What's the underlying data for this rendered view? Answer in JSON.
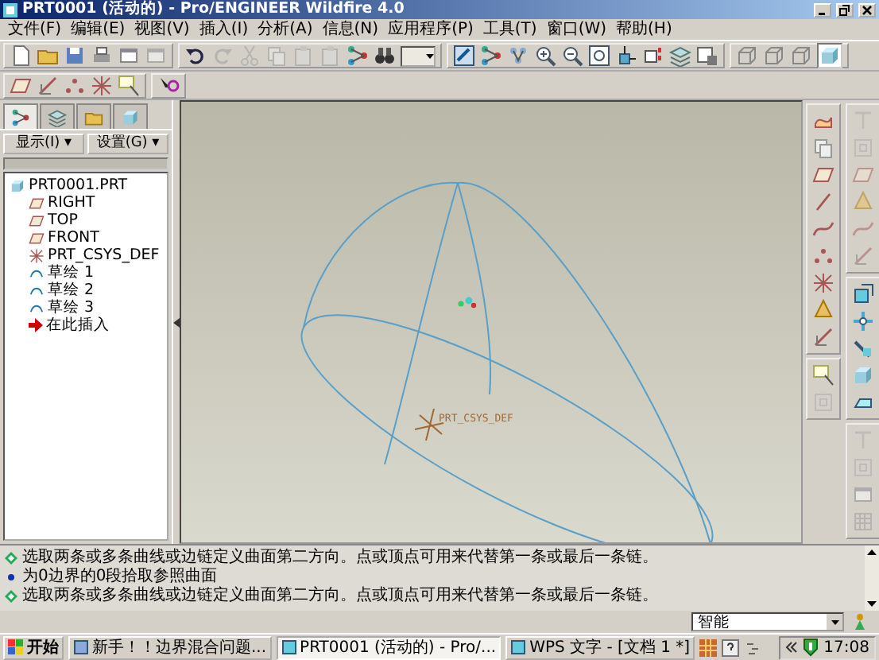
{
  "window": {
    "title": "PRT0001 (活动的) - Pro/ENGINEER Wildfire 4.0"
  },
  "menu": [
    "文件(F)",
    "编辑(E)",
    "视图(V)",
    "插入(I)",
    "分析(A)",
    "信息(N)",
    "应用程序(P)",
    "工具(T)",
    "窗口(W)",
    "帮助(H)"
  ],
  "navigator": {
    "tabs": [
      {
        "kind": "tree",
        "selected": true
      },
      {
        "kind": "layers",
        "selected": false
      },
      {
        "kind": "folder",
        "selected": false
      },
      {
        "kind": "favorites",
        "selected": false
      }
    ],
    "buttons": [
      "显示(I) ▾",
      "设置(G) ▾"
    ],
    "tree": [
      {
        "label": "PRT0001.PRT",
        "kind": "part",
        "children": [
          {
            "label": "RIGHT",
            "kind": "plane"
          },
          {
            "label": "TOP",
            "kind": "plane"
          },
          {
            "label": "FRONT",
            "kind": "plane"
          },
          {
            "label": "PRT_CSYS_DEF",
            "kind": "csys"
          },
          {
            "label": "草绘 1",
            "kind": "sketch"
          },
          {
            "label": "草绘 2",
            "kind": "sketch"
          },
          {
            "label": "草绘 3",
            "kind": "sketch"
          },
          {
            "label": "在此插入",
            "kind": "insert"
          }
        ]
      }
    ]
  },
  "viewport": {
    "csys_label": "PRT_CSYS_DEF"
  },
  "messages": [
    {
      "kind": "prompt",
      "text": "选取两条或多条曲线或边链定义曲面第二方向。点或顶点可用来代替第一条或最后一条链。"
    },
    {
      "kind": "info",
      "text": "为0边界的0段拾取参照曲面"
    },
    {
      "kind": "prompt",
      "text": "选取两条或多条曲线或边链定义曲面第二方向。点或顶点可用来代替第一条或最后一条链。"
    }
  ],
  "filter": {
    "value": "智能"
  },
  "taskbar": {
    "start": "开始",
    "tasks": [
      {
        "label": "新手！！边界混合问题...",
        "selected": false
      },
      {
        "label": "PRT0001 (活动的) - Pro/...",
        "selected": true
      },
      {
        "label": "WPS 文字 - [文档 1 *]",
        "selected": false
      }
    ],
    "clock": "17:08"
  }
}
